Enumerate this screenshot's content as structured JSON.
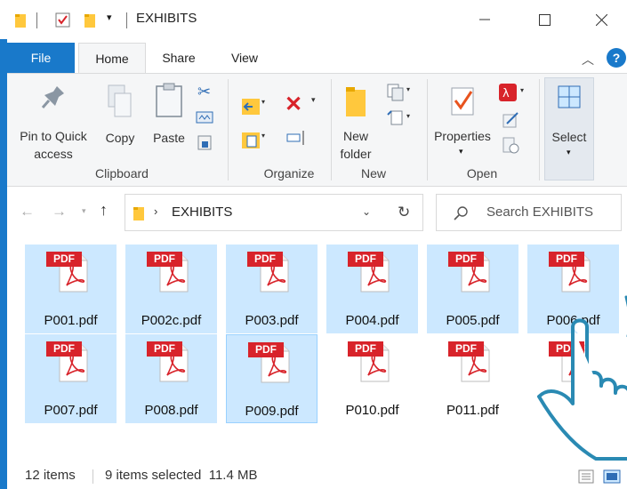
{
  "window": {
    "title": "EXHIBITS"
  },
  "tabs": [
    {
      "label": "File"
    },
    {
      "label": "Home"
    },
    {
      "label": "Share"
    },
    {
      "label": "View"
    }
  ],
  "ribbon": {
    "pin_label": "Pin to Quick access",
    "copy_label": "Copy",
    "paste_label": "Paste",
    "new_folder_label": "New folder",
    "properties_label": "Properties",
    "select_label": "Select",
    "groups": [
      "Clipboard",
      "Organize",
      "New",
      "Open"
    ]
  },
  "address": {
    "crumb": "EXHIBITS"
  },
  "search": {
    "placeholder": "Search EXHIBITS"
  },
  "files": [
    {
      "name": "P001.pdf",
      "selected": true
    },
    {
      "name": "P002c.pdf",
      "selected": true
    },
    {
      "name": "P003.pdf",
      "selected": true
    },
    {
      "name": "P004.pdf",
      "selected": true
    },
    {
      "name": "P005.pdf",
      "selected": true
    },
    {
      "name": "P006.pdf",
      "selected": true
    },
    {
      "name": "P007.pdf",
      "selected": true
    },
    {
      "name": "P008.pdf",
      "selected": true
    },
    {
      "name": "P009.pdf",
      "selected": true
    },
    {
      "name": "P010.pdf",
      "selected": false
    },
    {
      "name": "P011.pdf",
      "selected": false
    },
    {
      "name": "",
      "selected": false
    }
  ],
  "pdf_badge": "PDF",
  "status": {
    "count": "12 items",
    "selection": "9 items selected  11.4 MB"
  },
  "colors": {
    "accent": "#1979ca",
    "selection": "#cce8ff",
    "pdf_red": "#d8232a",
    "hand_outline": "#2a8ab3"
  }
}
